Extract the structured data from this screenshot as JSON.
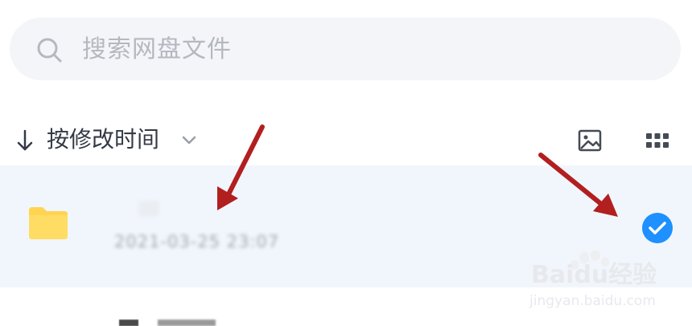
{
  "search": {
    "placeholder": "搜索网盘文件"
  },
  "sort": {
    "label": "按修改时间"
  },
  "files": [
    {
      "meta": "2021-03-25  23:07",
      "selected": true
    }
  ],
  "watermark": {
    "brand": "Baidu经验",
    "url": "jingyan.baidu.com"
  },
  "colors": {
    "accent": "#1e90ff",
    "folder": "#ffd451",
    "arrow": "#b21f1f",
    "selected_row": "#f1f6fc"
  }
}
